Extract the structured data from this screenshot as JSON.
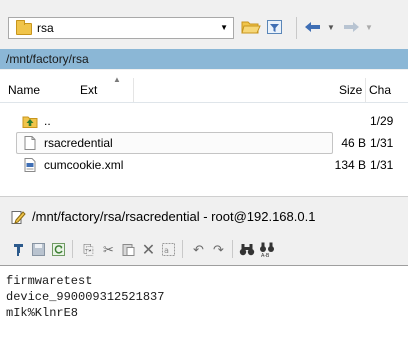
{
  "toolbar": {
    "path_combo_value": "rsa",
    "open_folder_icon": "open-folder-icon",
    "filter_icon": "filter-icon",
    "back_icon": "back-arrow-icon",
    "forward_icon": "forward-arrow-icon"
  },
  "breadcrumb": {
    "path": "/mnt/factory/rsa"
  },
  "file_list": {
    "columns": {
      "name": "Name",
      "ext": "Ext",
      "size": "Size",
      "changed": "Cha"
    },
    "rows": [
      {
        "name": "..",
        "size": "",
        "changed": "1/29",
        "icon": "parent-directory-icon"
      },
      {
        "name": "rsacredential",
        "size": "46 B",
        "changed": "1/31",
        "icon": "file-icon",
        "selected": true
      },
      {
        "name": "cumcookie.xml",
        "size": "134 B",
        "changed": "1/31",
        "icon": "xml-file-icon"
      }
    ]
  },
  "editor": {
    "title": "/mnt/factory/rsa/rsacredential - root@192.168.0.1",
    "lines": [
      "firmwaretest",
      "device_990009312521837",
      "mIk%KlnrE8"
    ]
  },
  "colors": {
    "breadcrumb_bg": "#8bb7d6",
    "window_bg": "#f0f0f0",
    "folder_yellow": "#f0c44a",
    "nav_arrow_blue": "#3f6fb5"
  }
}
